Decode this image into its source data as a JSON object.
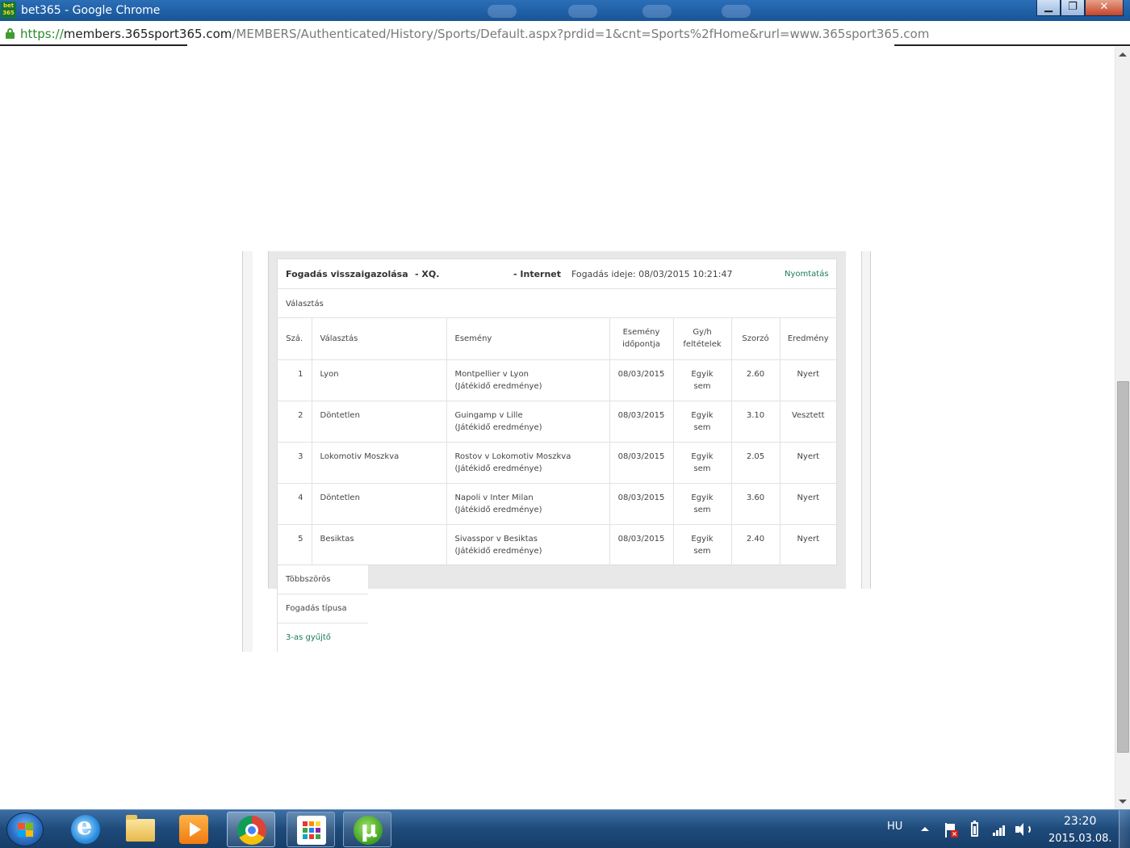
{
  "window": {
    "title": "bet365 - Google Chrome",
    "app_icon_text": "bet 365",
    "buttons": {
      "minimize": "▁",
      "maximize": "❐",
      "close": "✕"
    }
  },
  "address_bar": {
    "scheme": "https://",
    "host": "members.365sport365.com",
    "path": "/MEMBERS/Authenticated/History/Sports/Default.aspx?prdid=1&cnt=Sports%2fHome&rurl=www.365sport365.com"
  },
  "receipt": {
    "title": "Fogadás visszaigazolása",
    "ref": "- XQ.",
    "channel": "- Internet",
    "time_label": "Fogadás ideje:  08/03/2015 10:21:47",
    "print_label": "Nyomtatás",
    "selection_heading": "Választás",
    "columns": {
      "num": "Szá.",
      "selection": "Választás",
      "event": "Esemény",
      "event_time": "Esemény időpontja",
      "conditions": "Gy/h feltételek",
      "odds": "Szorzó",
      "result": "Eredmény"
    },
    "rows": [
      {
        "num": "1",
        "selection": "Lyon",
        "event": "Montpellier v Lyon",
        "market": "(Játékidő eredménye)",
        "date": "08/03/2015",
        "cond1": "Egyik",
        "cond2": "sem",
        "odds": "2.60",
        "result": "Nyert"
      },
      {
        "num": "2",
        "selection": "Döntetlen",
        "event": "Guingamp v Lille",
        "market": "(Játékidő eredménye)",
        "date": "08/03/2015",
        "cond1": "Egyik",
        "cond2": "sem",
        "odds": "3.10",
        "result": "Vesztett"
      },
      {
        "num": "3",
        "selection": "Lokomotiv Moszkva",
        "event": "Rostov v Lokomotiv Moszkva",
        "market": "(Játékidő eredménye)",
        "date": "08/03/2015",
        "cond1": "Egyik",
        "cond2": "sem",
        "odds": "2.05",
        "result": "Nyert"
      },
      {
        "num": "4",
        "selection": "Döntetlen",
        "event": "Napoli v Inter Milan",
        "market": "(Játékidő eredménye)",
        "date": "08/03/2015",
        "cond1": "Egyik",
        "cond2": "sem",
        "odds": "3.60",
        "result": "Nyert"
      },
      {
        "num": "5",
        "selection": "Besiktas",
        "event": "Sivasspor v Besiktas",
        "market": "(Játékidő eredménye)",
        "date": "08/03/2015",
        "cond1": "Egyik",
        "cond2": "sem",
        "odds": "2.40",
        "result": "Nyert"
      }
    ],
    "multiple_label": "Többszörös",
    "bet_type_label": "Fogadás típusa",
    "bet_type_value": "3-as gyűjtő"
  },
  "taskbar": {
    "lang": "HU",
    "time": "23:20",
    "date": "2015.03.08.",
    "items": [
      "start-orb",
      "internet-explorer-icon",
      "file-explorer-icon",
      "media-player-icon",
      "chrome-icon",
      "apps-grid-icon",
      "utorrent-icon"
    ]
  },
  "colors": {
    "link_green": "#1d7a57",
    "titlebar_blue": "#1f5fa5",
    "text_gray": "#444444"
  }
}
